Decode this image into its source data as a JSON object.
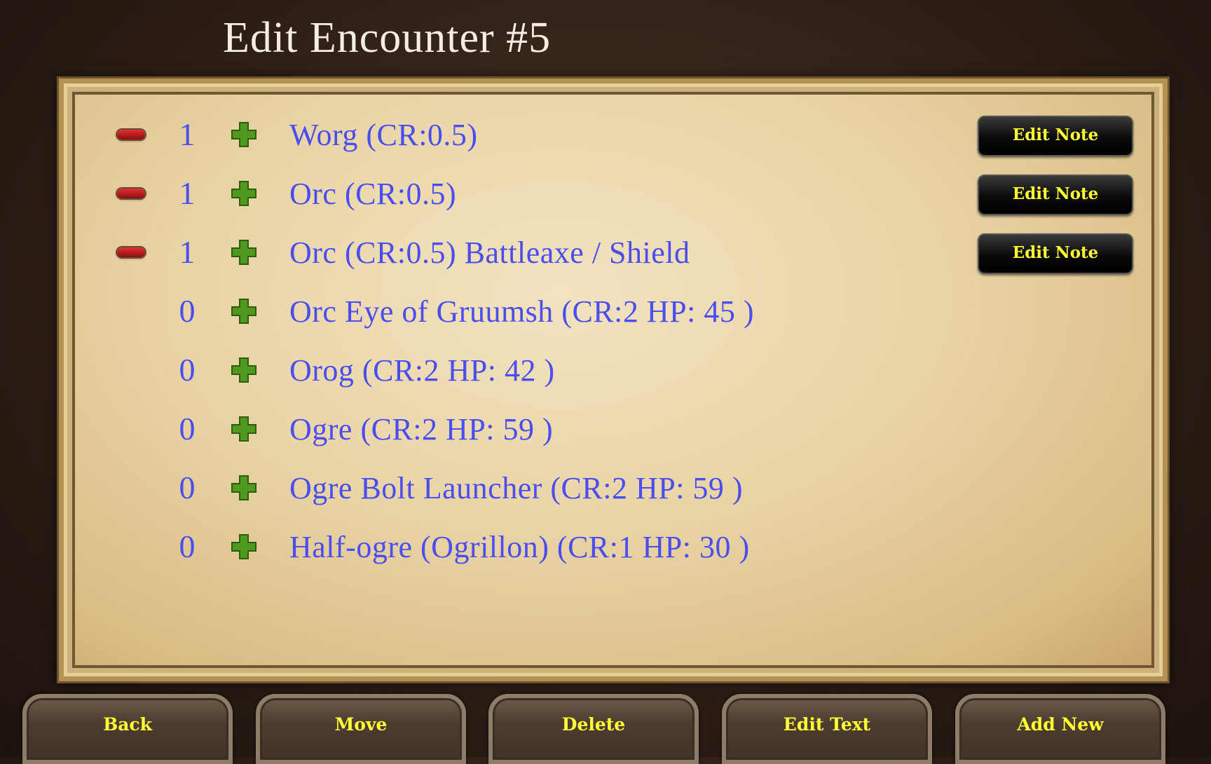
{
  "header": {
    "title": "Edit Encounter #5"
  },
  "rows": [
    {
      "count": "1",
      "name": "Worg (CR:0.5)",
      "has_minus": true,
      "note_label": "Edit Note"
    },
    {
      "count": "1",
      "name": "Orc (CR:0.5)",
      "has_minus": true,
      "note_label": "Edit Note"
    },
    {
      "count": "1",
      "name": "Orc (CR:0.5) Battleaxe / Shield",
      "has_minus": true,
      "note_label": "Edit Note"
    },
    {
      "count": "0",
      "name": "Orc Eye of Gruumsh (CR:2 HP: 45 )",
      "has_minus": false
    },
    {
      "count": "0",
      "name": "Orog (CR:2 HP: 42 )",
      "has_minus": false
    },
    {
      "count": "0",
      "name": "Ogre (CR:2 HP: 59 )",
      "has_minus": false
    },
    {
      "count": "0",
      "name": "Ogre Bolt Launcher (CR:2 HP: 59 )",
      "has_minus": false
    },
    {
      "count": "0",
      "name": "Half-ogre (Ogrillon) (CR:1 HP: 30 )",
      "has_minus": false
    }
  ],
  "toolbar": {
    "back": "Back",
    "move": "Move",
    "delete": "Delete",
    "edit_text": "Edit Text",
    "add_new": "Add New"
  },
  "colors": {
    "entry_text": "#4a4ef2",
    "button_text": "#ffff33",
    "minus": "#c01818",
    "plus": "#4f9a1e"
  },
  "icons": {
    "decrement": "minus-icon",
    "increment": "plus-icon"
  }
}
